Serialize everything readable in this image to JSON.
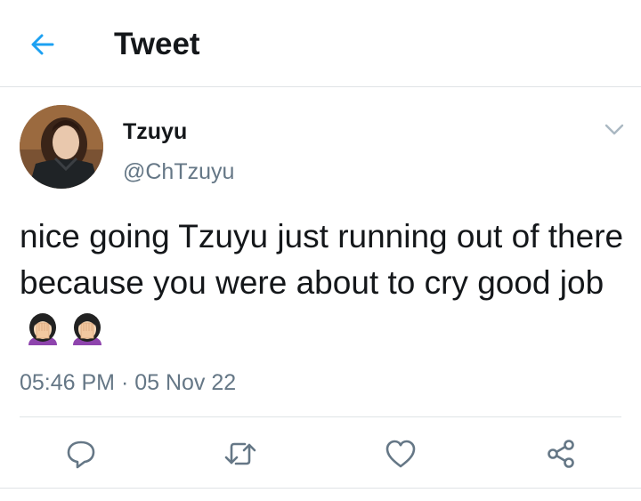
{
  "header": {
    "title": "Tweet",
    "back_icon": "arrow-left-icon",
    "accent_color": "#1da1f2"
  },
  "tweet": {
    "author": {
      "display_name": "Tzuyu",
      "handle": "@ChTzuyu",
      "avatar_icon": "profile-photo"
    },
    "text": "nice going Tzuyu just running out of there because you were about to cry good job",
    "emojis": [
      "person-facepalming-emoji",
      "person-facepalming-emoji"
    ],
    "timestamp": "05:46 PM · 05 Nov 22",
    "menu_icon": "chevron-down-icon"
  },
  "actions": [
    {
      "name": "reply",
      "icon": "reply-icon"
    },
    {
      "name": "retweet",
      "icon": "retweet-icon"
    },
    {
      "name": "like",
      "icon": "heart-icon"
    },
    {
      "name": "share",
      "icon": "share-icon"
    }
  ],
  "colors": {
    "text_primary": "#14171a",
    "text_secondary": "#657786",
    "divider": "#dfe3e6",
    "icon_gray": "#657786"
  }
}
